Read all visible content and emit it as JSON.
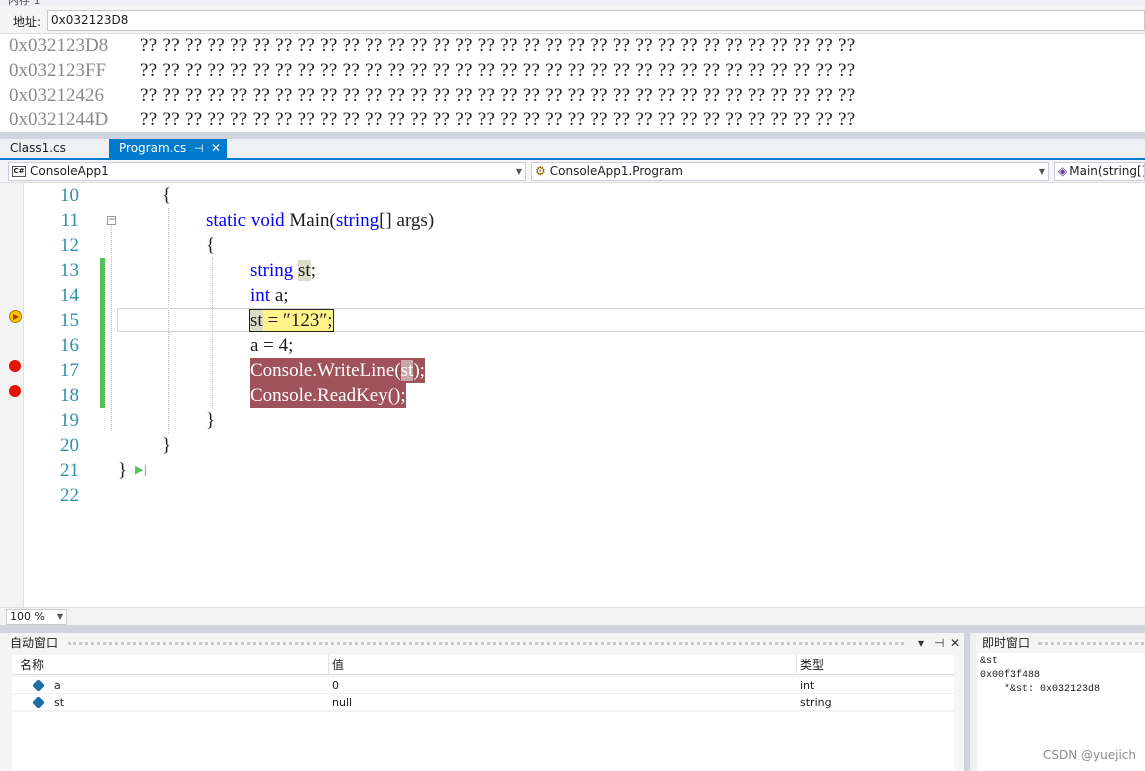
{
  "memory": {
    "address_label": "地址:",
    "address_value": "0x032123D8",
    "rows": [
      {
        "addr": "0x032123D8",
        "bytes": "?? ?? ?? ?? ?? ?? ?? ?? ?? ?? ?? ?? ?? ?? ?? ?? ?? ?? ?? ?? ?? ?? ?? ?? ?? ?? ?? ?? ?? ?? ?? ??"
      },
      {
        "addr": "0x032123FF",
        "bytes": "?? ?? ?? ?? ?? ?? ?? ?? ?? ?? ?? ?? ?? ?? ?? ?? ?? ?? ?? ?? ?? ?? ?? ?? ?? ?? ?? ?? ?? ?? ?? ??"
      },
      {
        "addr": "0x03212426",
        "bytes": "?? ?? ?? ?? ?? ?? ?? ?? ?? ?? ?? ?? ?? ?? ?? ?? ?? ?? ?? ?? ?? ?? ?? ?? ?? ?? ?? ?? ?? ?? ?? ??"
      },
      {
        "addr": "0x0321244D",
        "bytes": "?? ?? ?? ?? ?? ?? ?? ?? ?? ?? ?? ?? ?? ?? ?? ?? ?? ?? ?? ?? ?? ?? ?? ?? ?? ?? ?? ?? ?? ?? ?? ??"
      }
    ]
  },
  "tabs": {
    "class1": "Class1.cs",
    "program": "Program.cs",
    "pin": "⊣",
    "close": "✕"
  },
  "navbar": {
    "project": "ConsoleApp1",
    "class": "ConsoleApp1.Program",
    "member": "Main(string[] args)",
    "cs_badge": "C#"
  },
  "editor": {
    "line_numbers": [
      "10",
      "11",
      "12",
      "13",
      "14",
      "15",
      "16",
      "17",
      "18",
      "19",
      "20",
      "21",
      "22"
    ],
    "code": {
      "l10": "{",
      "l11_kw1": "static",
      "l11_kw2": "void",
      "l11_name": "Main(",
      "l11_kw3": "string",
      "l11_rest": "[] args)",
      "l12": "{",
      "l13_kw": "string",
      "l13_var": "st",
      "l13_end": ";",
      "l14_kw": "int",
      "l14_rest": "a;",
      "l15_var": "st",
      "l15_rest": " = ″123″;",
      "l16": "a = 4;",
      "l17_a": "Console.WriteLine(",
      "l17_var": "st",
      "l17_b": ");",
      "l18": "Console.ReadKey();",
      "l19": "}",
      "l20": "}",
      "l21": "}"
    }
  },
  "zoom": "100 %",
  "autos": {
    "title": "自动窗口",
    "col_name": "名称",
    "col_value": "值",
    "col_type": "类型",
    "rows": [
      {
        "name": "a",
        "value": "0",
        "type": "int"
      },
      {
        "name": "st",
        "value": "null",
        "type": "string"
      }
    ],
    "dropdown": "▾",
    "pin": "⊣",
    "close": "✕"
  },
  "immediate": {
    "title": "即时窗口",
    "lines": [
      "&st",
      "0x00f3f488",
      "*&st: 0x032123d8"
    ]
  },
  "watermark": "CSDN @yuejich",
  "colors": {
    "accent": "#007acc",
    "breakpoint": "#e51400",
    "breakpoint_line": "#a0525a",
    "current_statement": "#fff38a",
    "keyword": "#0000ff",
    "line_number": "#2b91af"
  }
}
